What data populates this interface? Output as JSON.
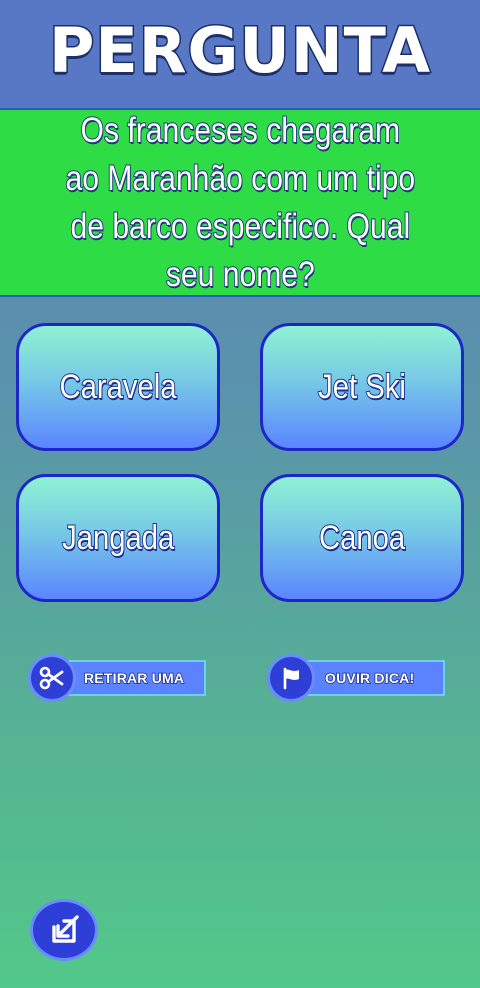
{
  "header": {
    "title": "PERGUNTA"
  },
  "question": {
    "lines": [
      "Os franceses chegaram",
      "ao Maranhão com um tipo",
      "de barco especifico. Qual",
      "seu nome?"
    ]
  },
  "answers": [
    {
      "label": "Caravela"
    },
    {
      "label": "Jet Ski"
    },
    {
      "label": "Jangada"
    },
    {
      "label": "Canoa"
    }
  ],
  "helpers": [
    {
      "label": "RETIRAR UMA",
      "icon": "scissors-icon"
    },
    {
      "label": "OUVIR DICA!",
      "icon": "flag-icon"
    }
  ],
  "footer": {
    "exit_icon": "exit-icon"
  },
  "colors": {
    "header_bg": "#5877c4",
    "question_bg": "#2edc45",
    "answer_border": "#1d27c8",
    "helper_circle": "#2e3fd8"
  }
}
